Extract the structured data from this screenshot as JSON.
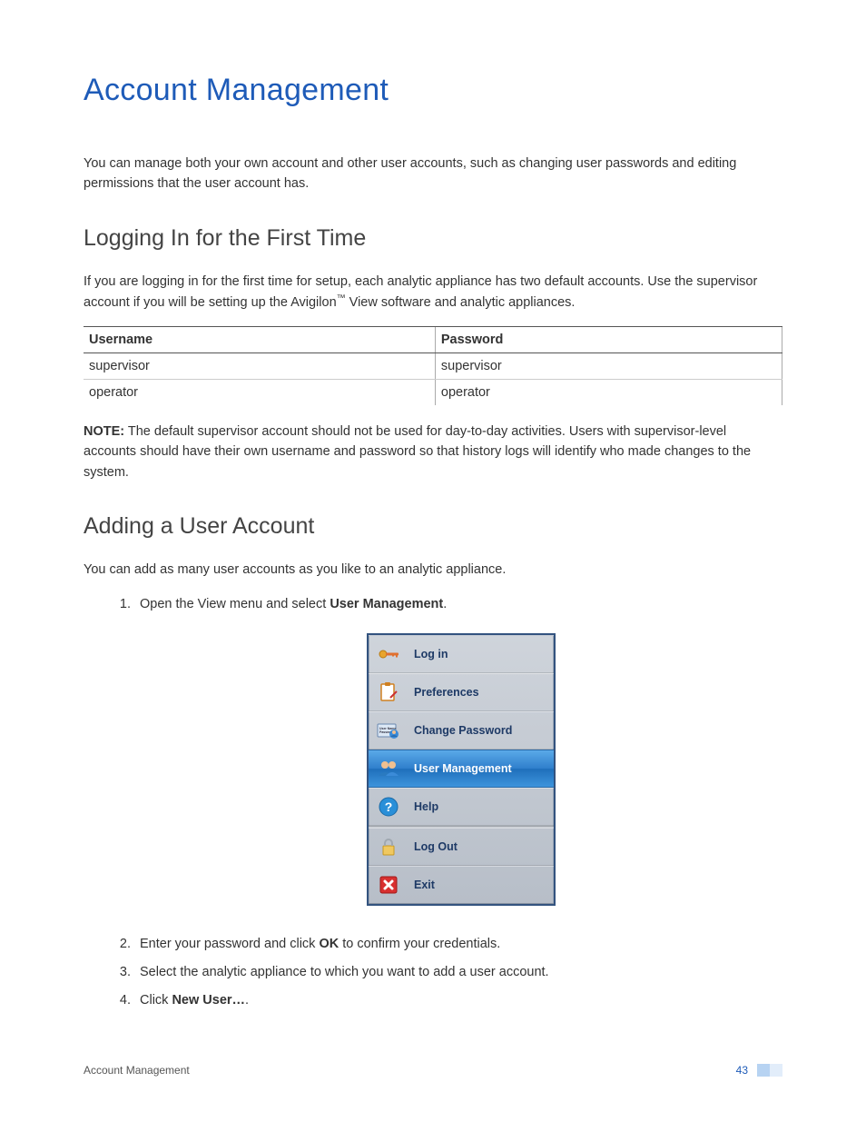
{
  "title": "Account Management",
  "intro": "You can manage both your own account and other user accounts, such as changing user passwords and editing permissions that the user account has.",
  "section1": {
    "heading": "Logging In for the First Time",
    "p1_a": "If you are logging in for the first time for setup, each analytic appliance has two default accounts. Use the supervisor account if you will be setting up the Avigilon",
    "p1_tm": "™",
    "p1_b": " View software and analytic appliances.",
    "table": {
      "headers": [
        "Username",
        "Password"
      ],
      "rows": [
        [
          "supervisor",
          "supervisor"
        ],
        [
          "operator",
          "operator"
        ]
      ]
    },
    "note_label": "NOTE:",
    "note_text": " The default supervisor account should not be used for day-to-day activities. Users with supervisor-level accounts should have their own username and password so that history logs will identify who made changes to the system."
  },
  "section2": {
    "heading": "Adding a User Account",
    "p1": "You can add as many user accounts as you like to an analytic appliance.",
    "steps": {
      "s1_a": "Open the View menu and select ",
      "s1_b": "User Management",
      "s1_c": ".",
      "s2_a": "Enter your password and click ",
      "s2_b": "OK",
      "s2_c": " to confirm your credentials.",
      "s3": "Select the analytic appliance to which you want to add a user account.",
      "s4_a": "Click ",
      "s4_b": "New User…",
      "s4_c": "."
    }
  },
  "menu": {
    "items": [
      {
        "label": "Log in",
        "selected": false
      },
      {
        "label": "Preferences",
        "selected": false
      },
      {
        "label": "Change Password",
        "selected": false
      },
      {
        "label": "User Management",
        "selected": true
      },
      {
        "label": "Help",
        "selected": false
      },
      {
        "label": "Log Out",
        "selected": false
      },
      {
        "label": "Exit",
        "selected": false
      }
    ]
  },
  "footer": {
    "section": "Account Management",
    "page": "43"
  }
}
